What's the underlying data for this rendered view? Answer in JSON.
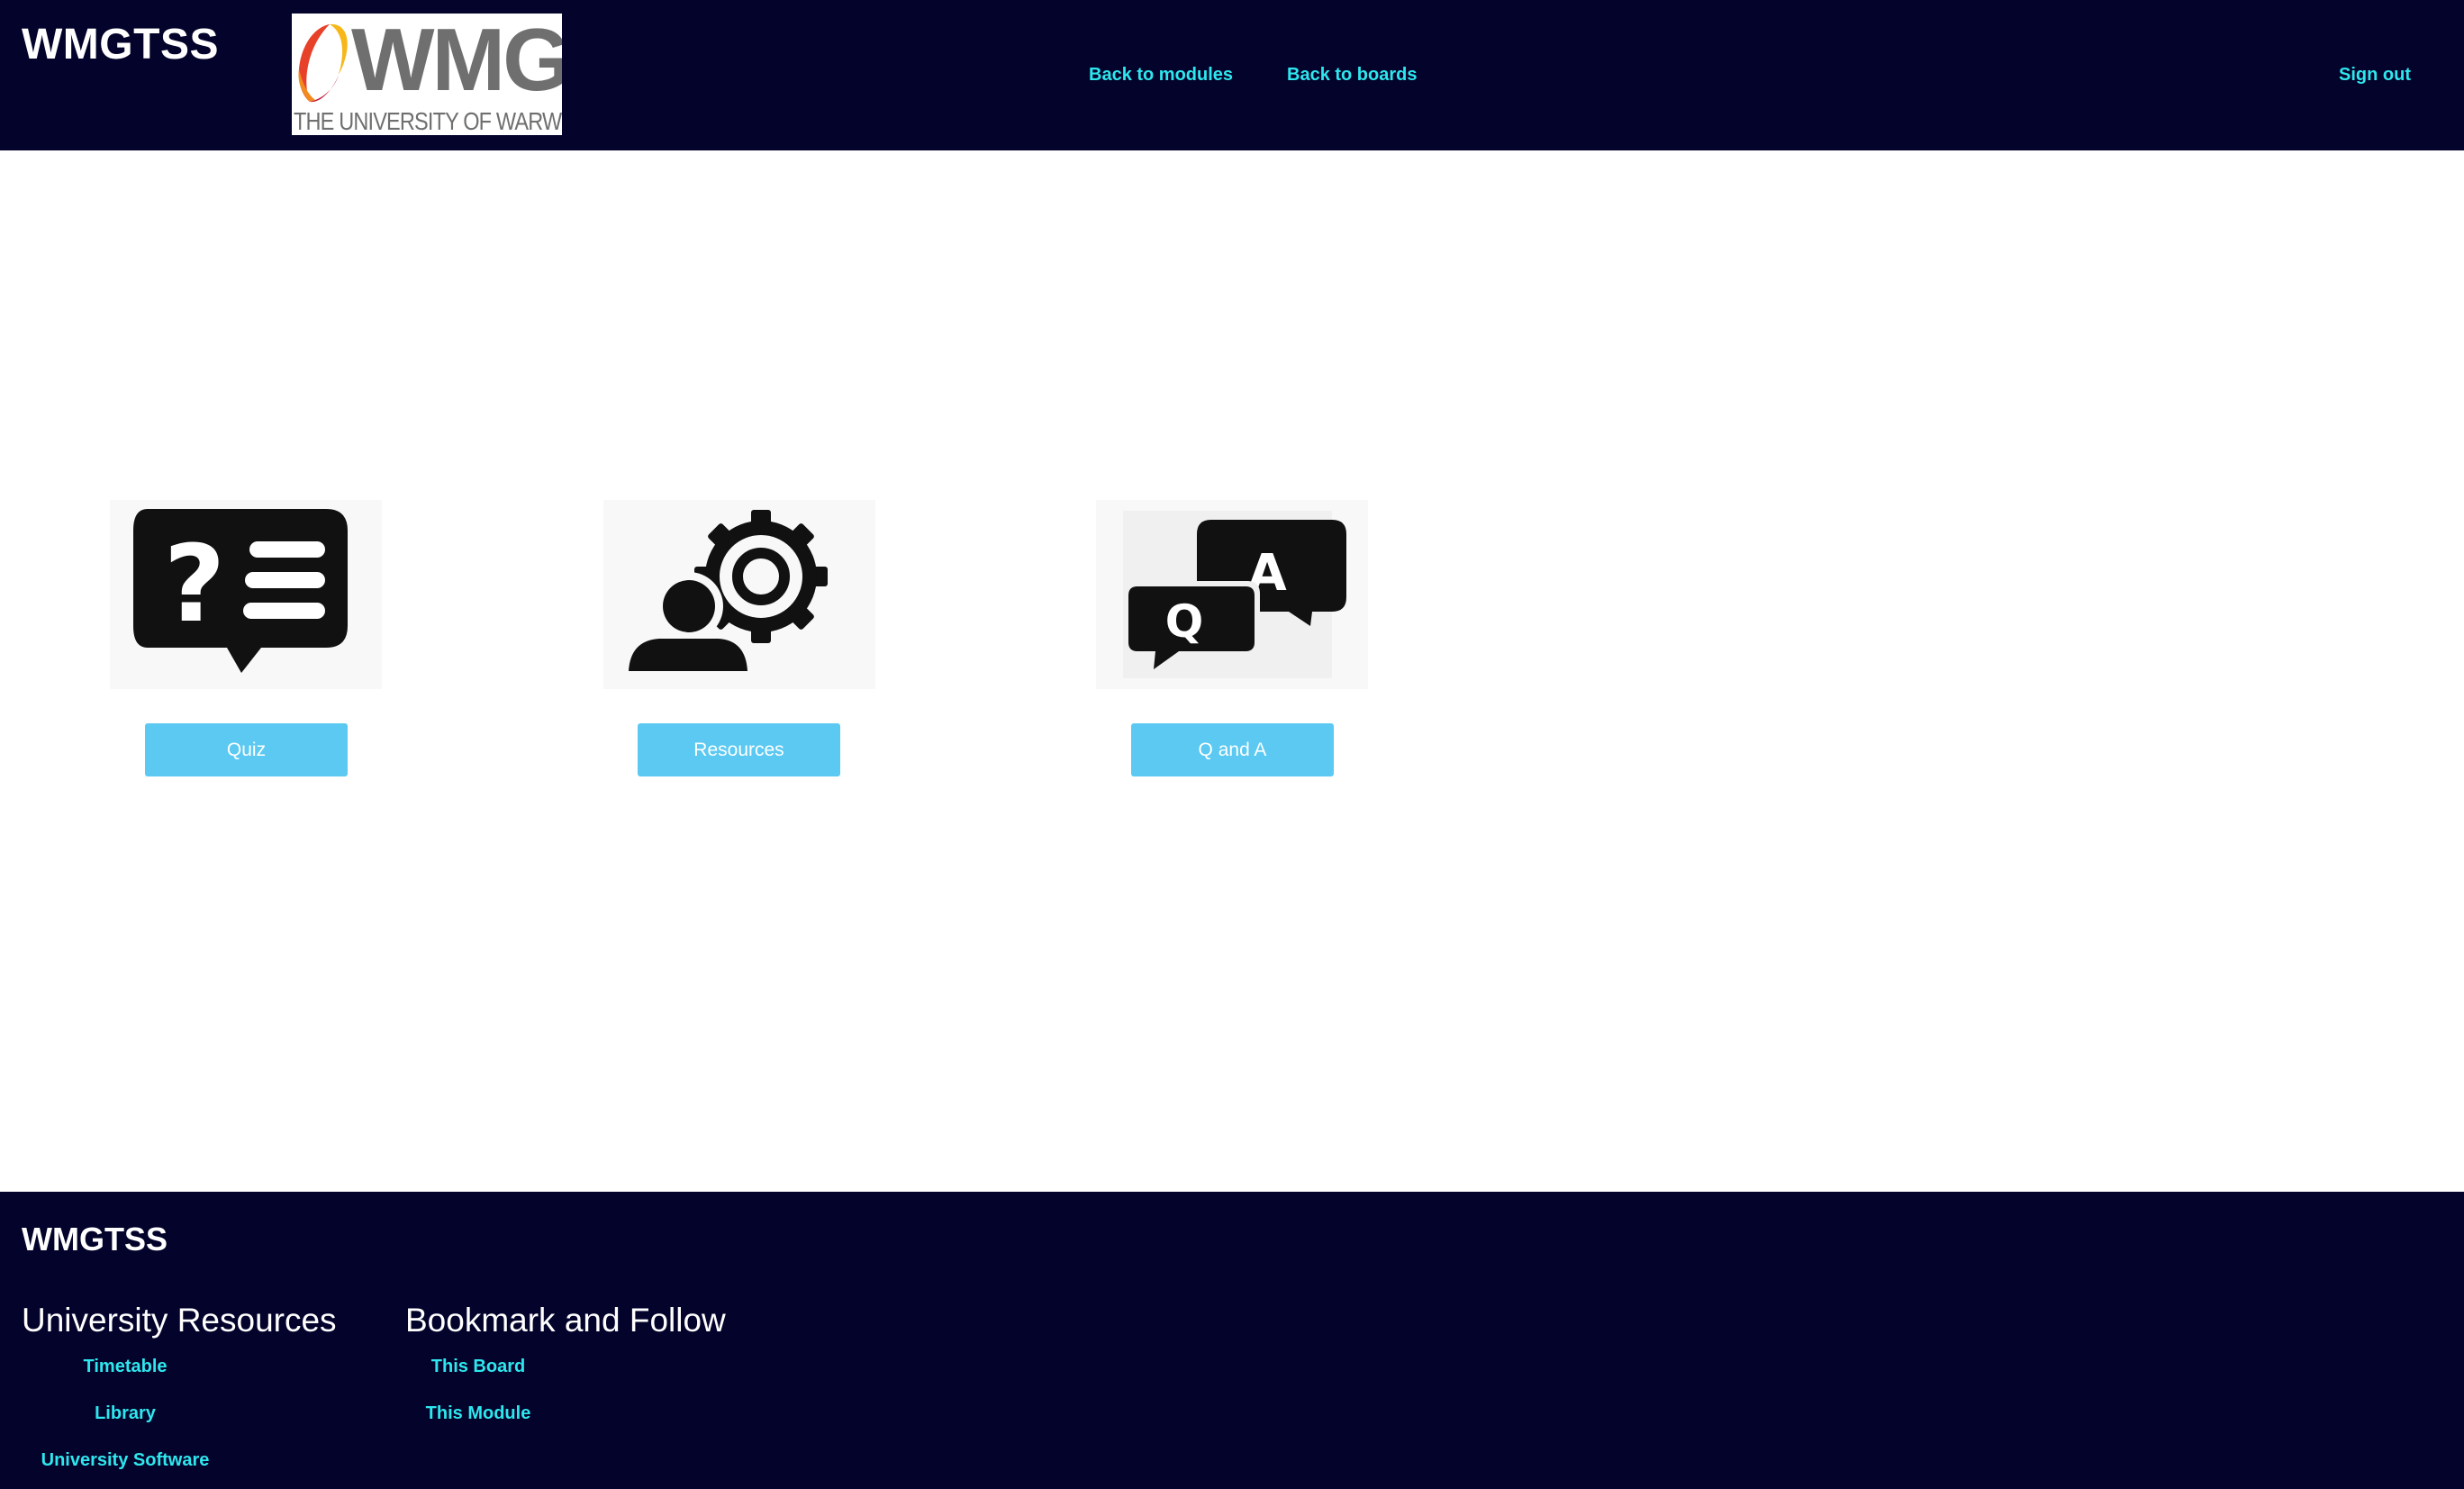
{
  "header": {
    "brand": "WMGTSS",
    "logo": {
      "wordmark": "WMG",
      "subtitle": "THE UNIVERSITY OF WARWICK"
    },
    "nav": {
      "back_to_modules": "Back to modules",
      "back_to_boards": "Back to boards",
      "sign_out": "Sign out"
    }
  },
  "cards": [
    {
      "icon": "quiz-speech-bubble-icon",
      "label": "Quiz"
    },
    {
      "icon": "person-gear-icon",
      "label": "Resources"
    },
    {
      "icon": "qa-speech-bubbles-icon",
      "label": "Q and A"
    }
  ],
  "footer": {
    "brand": "WMGTSS",
    "university_resources": {
      "heading": "University Resources",
      "links": [
        "Timetable",
        "Library",
        "University Software"
      ]
    },
    "bookmark_follow": {
      "heading": "Bookmark and Follow",
      "links": [
        "This Board",
        "This Module"
      ]
    }
  },
  "colors": {
    "navy": "#03032b",
    "link_cyan": "#2ee7ee",
    "button_blue": "#5bc9f1"
  }
}
